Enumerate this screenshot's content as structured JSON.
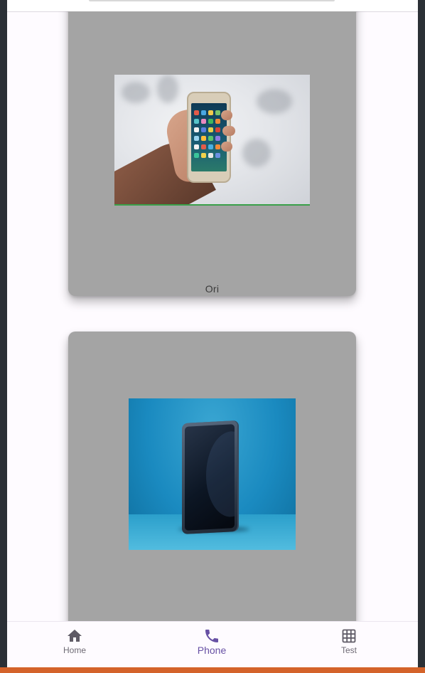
{
  "cards": [
    {
      "caption": "Ori",
      "image": "hand-holding-phone"
    },
    {
      "caption": "",
      "image": "phone-on-blue-background"
    }
  ],
  "bottom_nav": {
    "items": [
      {
        "label": "Home",
        "icon": "home-icon",
        "active": false
      },
      {
        "label": "Phone",
        "icon": "phone-icon",
        "active": true
      },
      {
        "label": "Test",
        "icon": "grid-icon",
        "active": false
      }
    ]
  },
  "colors": {
    "accent": "#6750a4",
    "card_bg": "#a4a4a4",
    "app_bg": "#fefbff",
    "inactive_icon": "#6e6a74"
  }
}
